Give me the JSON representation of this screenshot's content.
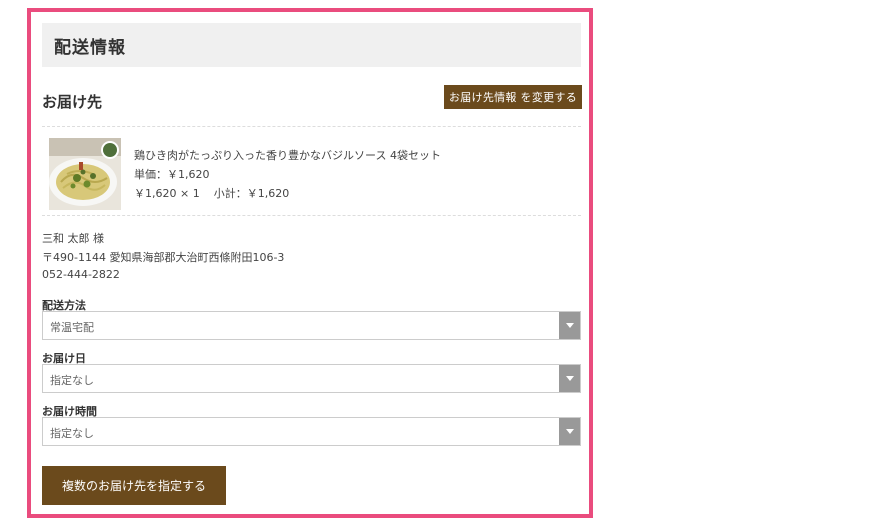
{
  "section": {
    "title": "配送情報"
  },
  "destination": {
    "title": "お届け先",
    "change_button": "お届け先情報 を変更する"
  },
  "product": {
    "image": "pasta-image",
    "name": "鶏ひき肉がたっぷり入った香り豊かなバジルソース 4袋セット",
    "unit_price": "単価：￥1,620",
    "qty_line": "￥1,620 × 1",
    "subtotal": "小計：￥1,620"
  },
  "address": {
    "name": "三和 太郎 様",
    "postal_address": "〒490-1144 愛知県海部郡大治町西條附田106-3",
    "phone": "052-444-2822"
  },
  "fields": {
    "shipping_method": {
      "label": "配送方法",
      "value": "常温宅配"
    },
    "delivery_date": {
      "label": "お届け日",
      "value": "指定なし"
    },
    "delivery_time": {
      "label": "お届け時間",
      "value": "指定なし"
    }
  },
  "multi_button": "複数のお届け先を指定する",
  "colors": {
    "frame": "#ea4c7e",
    "button": "#6b4a1c",
    "header_bg": "#f0f0f0",
    "select_arrow": "#999999"
  }
}
